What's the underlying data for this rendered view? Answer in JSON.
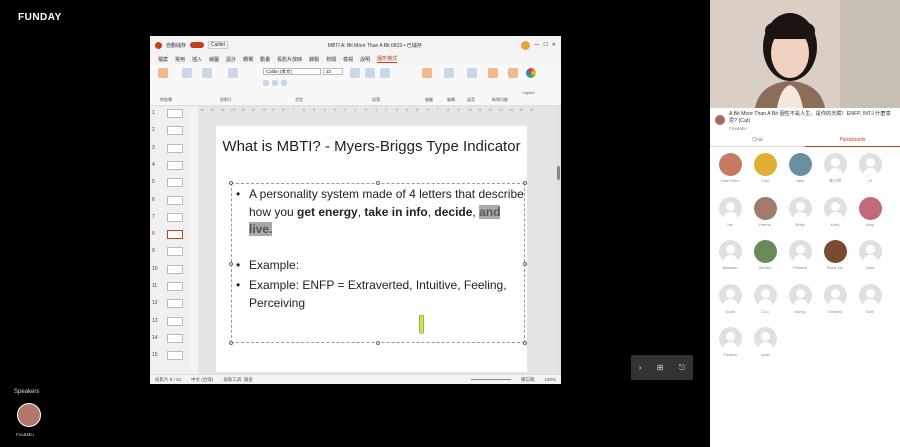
{
  "brand": "FUNDAY",
  "speakers": {
    "label": "Speakers",
    "name": "Fox&Miu"
  },
  "ppt": {
    "titlebar": {
      "autosave": "自動儲存",
      "toggle": "關閉",
      "font_box": "Calibri",
      "title": "MBTI A: Bit More Than A Bit 0819 • 已儲存",
      "window_controls": [
        "—",
        "☐",
        "✕"
      ]
    },
    "menu": [
      "檔案",
      "常用",
      "插入",
      "繪圖",
      "設計",
      "轉場",
      "動畫",
      "投影片放映",
      "錄製",
      "校閱",
      "檢視",
      "說明",
      "圖形格式"
    ],
    "ribbon": {
      "font": "Calibri (本文)",
      "size": "32",
      "copilot": "Copilot",
      "groups": [
        "剪貼簿",
        "投影片",
        "字型",
        "段落",
        "繪圖",
        "編輯",
        "語音",
        "新增功能"
      ]
    },
    "slide_numbers": [
      "1",
      "2",
      "3",
      "4",
      "5",
      "6",
      "7",
      "8",
      "9",
      "10",
      "11",
      "12",
      "13",
      "14",
      "15"
    ],
    "selected_slide": "8",
    "ruler_marks": [
      "16",
      "15",
      "14",
      "13",
      "12",
      "11",
      "10",
      "9",
      "8",
      "7",
      "6",
      "5",
      "4",
      "3",
      "2",
      "1",
      "0",
      "1",
      "2",
      "3",
      "4",
      "5",
      "6",
      "7",
      "8",
      "9",
      "10",
      "11",
      "12",
      "13",
      "14",
      "15",
      "16"
    ],
    "slide": {
      "title": "What is MBTI? - Myers-Briggs Type Indicator",
      "bullet1_plain1": "A personality system made of 4 letters that describe how you ",
      "bullet1_bold1": "get energy",
      "bullet1_plain2": ", ",
      "bullet1_bold2": "take in info",
      "bullet1_plain3": ", ",
      "bullet1_bold3": "decide",
      "bullet1_plain4": ", ",
      "bullet1_highlight": "and live.",
      "bullet2": "Example:",
      "bullet3": "Example: ENFP = Extraverted, Intuitive, Feeling, Perceiving"
    },
    "status": {
      "slide_info": "投影片 8 / 33",
      "lang": "中文 (台灣)",
      "accessibility": "協助工具: 調查",
      "notes": "備忘稿",
      "zoom": "100%"
    }
  },
  "controls": {
    "next": "›",
    "grid": "⊞",
    "exit": "⎋"
  },
  "panel": {
    "presentation_title": "A Bit More Than A Bit 個性不是人生，是你的天賦！ENFP, INTJ 什麼意思? (Cat)",
    "presenter": "Fox&Miu",
    "tabs": [
      "Chat",
      "Participants"
    ],
    "active_tab": "Participants",
    "participants": [
      {
        "name": "Yomi Chen",
        "color": "#c47a63"
      },
      {
        "name": "Yuki",
        "color": "#e0b030"
      },
      {
        "name": "Jake",
        "color": "#6b8fa0"
      },
      {
        "name": "林小明",
        "color": ""
      },
      {
        "name": "Vi",
        "color": ""
      },
      {
        "name": "Iris",
        "color": ""
      },
      {
        "name": "Hanna",
        "color": "#a07a6a"
      },
      {
        "name": "Ruby",
        "color": ""
      },
      {
        "name": "Kelly",
        "color": ""
      },
      {
        "name": "Amy",
        "color": "#c06a7a"
      },
      {
        "name": "Brandon",
        "color": ""
      },
      {
        "name": "Steven",
        "color": "#6a8a5a"
      },
      {
        "name": "Phoebe",
        "color": ""
      },
      {
        "name": "Rosa Wu",
        "color": "#7a4a30"
      },
      {
        "name": "Gary",
        "color": ""
      },
      {
        "name": "Scott",
        "color": ""
      },
      {
        "name": "Chu",
        "color": ""
      },
      {
        "name": "Sunny",
        "color": ""
      },
      {
        "name": "Charles",
        "color": ""
      },
      {
        "name": "Sam",
        "color": ""
      },
      {
        "name": "Paulina",
        "color": ""
      },
      {
        "name": "Lynn",
        "color": ""
      }
    ]
  }
}
